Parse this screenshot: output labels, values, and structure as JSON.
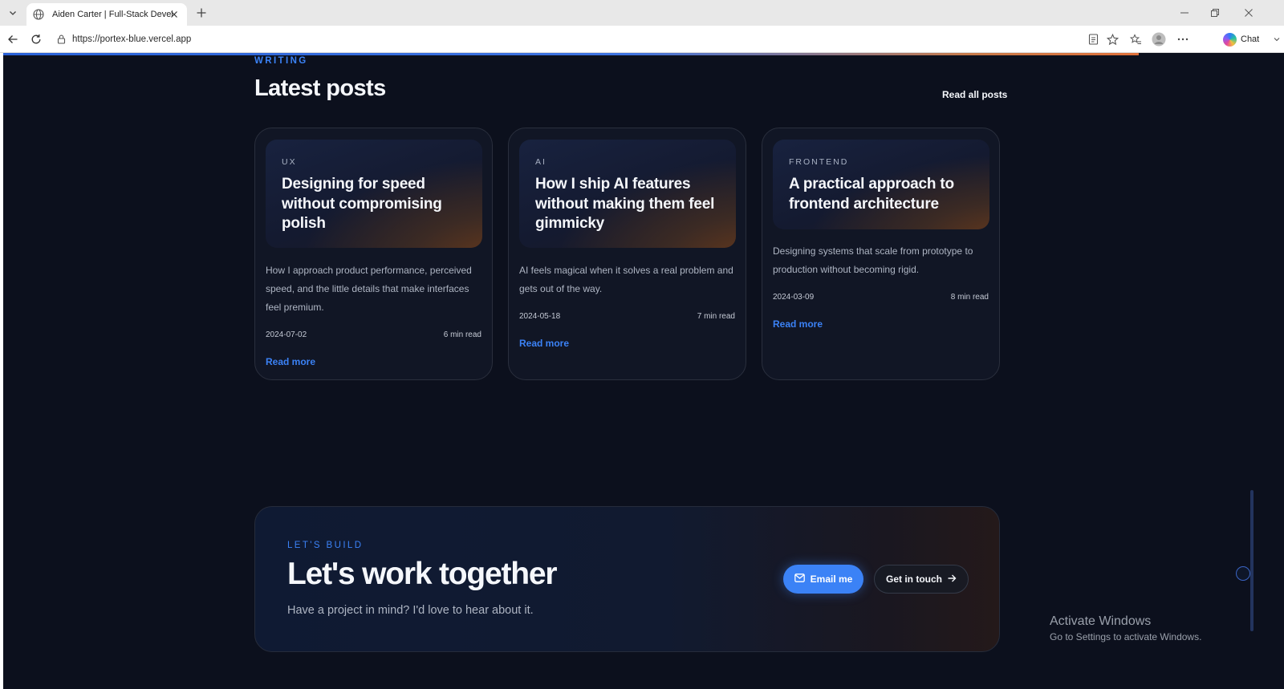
{
  "browser": {
    "tab_title": "Aiden Carter | Full-Stack Developer",
    "url": "https://portex-blue.vercel.app",
    "chat_label": "Chat"
  },
  "writing": {
    "kicker": "WRITING",
    "title": "Latest posts",
    "read_all": "Read all posts",
    "posts": [
      {
        "tag": "UX",
        "title": "Designing for speed without compromising polish",
        "description": "How I approach product performance, perceived speed, and the little details that make interfaces feel premium.",
        "date": "2024-07-02",
        "read_time": "6 min read",
        "link": "Read more"
      },
      {
        "tag": "AI",
        "title": "How I ship AI features without making them feel gimmicky",
        "description": "AI feels magical when it solves a real problem and gets out of the way.",
        "date": "2024-05-18",
        "read_time": "7 min read",
        "link": "Read more"
      },
      {
        "tag": "FRONTEND",
        "title": "A practical approach to frontend architecture",
        "description": "Designing systems that scale from prototype to production without becoming rigid.",
        "date": "2024-03-09",
        "read_time": "8 min read",
        "link": "Read more"
      }
    ]
  },
  "cta": {
    "kicker": "LET'S BUILD",
    "title": "Let's work together",
    "subtitle": "Have a project in mind? I'd love to hear about it.",
    "email_label": "Email me",
    "contact_label": "Get in touch"
  },
  "watermark": {
    "title": "Activate Windows",
    "subtitle": "Go to Settings to activate Windows."
  },
  "colors": {
    "accent": "#3b82f6",
    "background": "#0c101d"
  }
}
